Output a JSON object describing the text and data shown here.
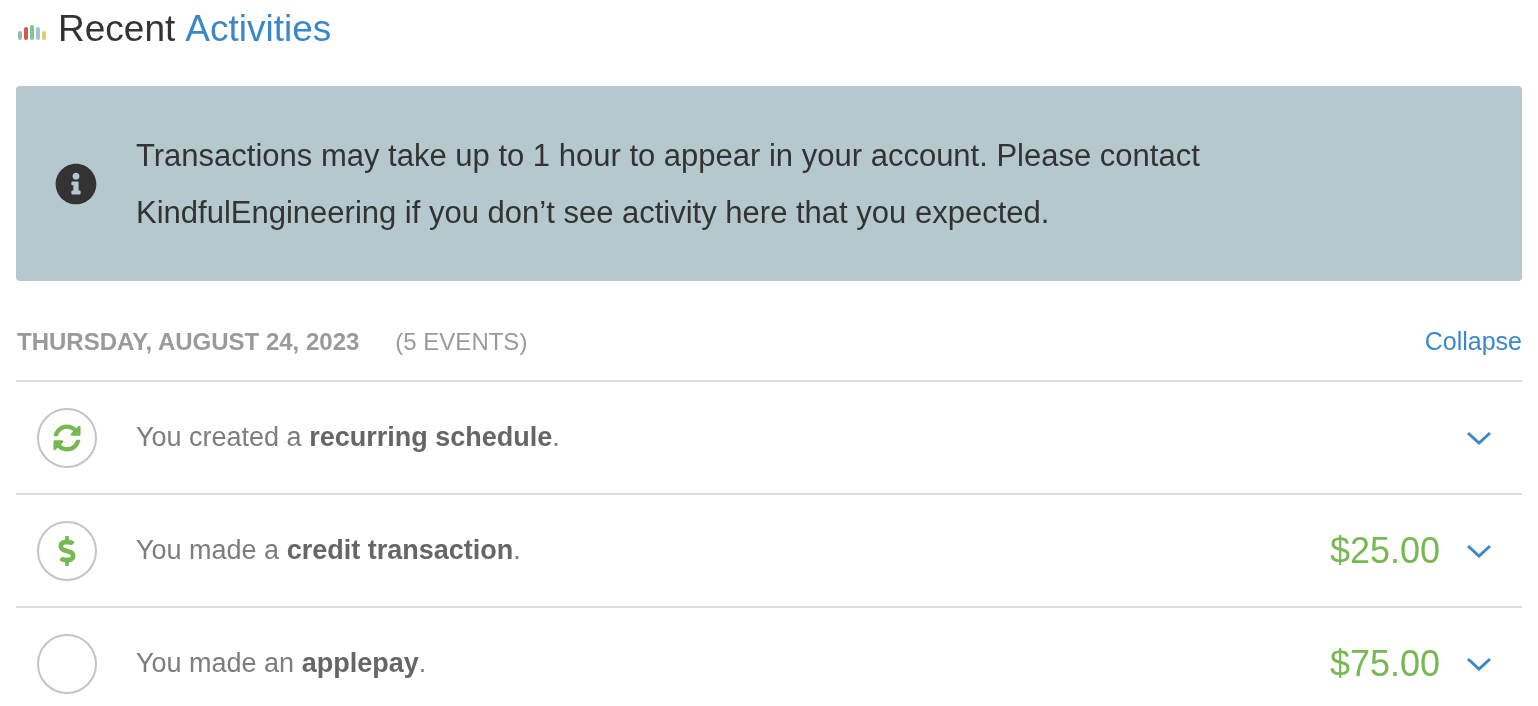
{
  "header": {
    "title_prefix": "Recent",
    "title_highlight": "Activities"
  },
  "notice": {
    "text": "Transactions may take up to 1 hour to appear in your account. Please contact KindfulEngineering if you don’t see activity here that you expected."
  },
  "groups": [
    {
      "date": "THURSDAY, AUGUST 24, 2023",
      "count": "(5 EVENTS)",
      "toggle": "Collapse",
      "events": [
        {
          "kind": "recurring",
          "text": "You created a **recurring schedule**.",
          "expanded": false
        },
        {
          "kind": "payment",
          "text": "You made a **credit transaction**.",
          "amount": "$25.00",
          "expanded": false
        },
        {
          "kind": "blank",
          "text": "You made an **applepay**.",
          "amount": "$75.00",
          "expanded": false
        }
      ]
    }
  ]
}
